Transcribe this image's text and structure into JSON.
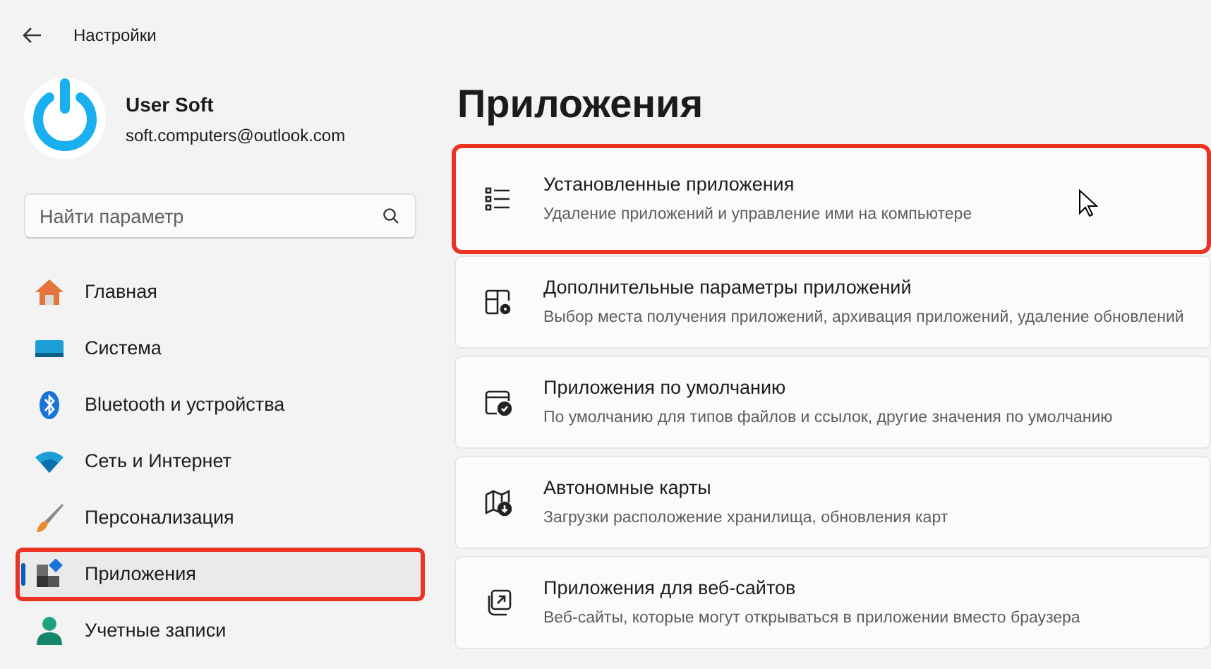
{
  "window": {
    "title": "Настройки"
  },
  "user": {
    "name": "User Soft",
    "email": "soft.computers@outlook.com"
  },
  "search": {
    "placeholder": "Найти параметр"
  },
  "sidebar": {
    "items": [
      {
        "label": "Главная",
        "kind": "home",
        "selected": false,
        "highlighted": false
      },
      {
        "label": "Система",
        "kind": "system",
        "selected": false,
        "highlighted": false
      },
      {
        "label": "Bluetooth и устройства",
        "kind": "bluetooth",
        "selected": false,
        "highlighted": false
      },
      {
        "label": "Сеть и Интернет",
        "kind": "network",
        "selected": false,
        "highlighted": false
      },
      {
        "label": "Персонализация",
        "kind": "brush",
        "selected": false,
        "highlighted": false
      },
      {
        "label": "Приложения",
        "kind": "apps",
        "selected": true,
        "highlighted": true
      },
      {
        "label": "Учетные записи",
        "kind": "account",
        "selected": false,
        "highlighted": false
      }
    ]
  },
  "page": {
    "title": "Приложения"
  },
  "cards": [
    {
      "title": "Установленные приложения",
      "description": "Удаление приложений и управление ими на компьютере",
      "kind": "list",
      "highlighted": true
    },
    {
      "title": "Дополнительные параметры приложений",
      "description": "Выбор места получения приложений, архивация приложений, удаление обновлений",
      "kind": "gear",
      "highlighted": false
    },
    {
      "title": "Приложения по умолчанию",
      "description": "По умолчанию для типов файлов и ссылок, другие значения по умолчанию",
      "kind": "check",
      "highlighted": false
    },
    {
      "title": "Автономные карты",
      "description": "Загрузки расположение хранилища, обновления карт",
      "kind": "map",
      "highlighted": false
    },
    {
      "title": "Приложения для веб-сайтов",
      "description": "Веб-сайты, которые могут открываться в приложении вместо браузера",
      "kind": "web",
      "highlighted": false
    }
  ]
}
